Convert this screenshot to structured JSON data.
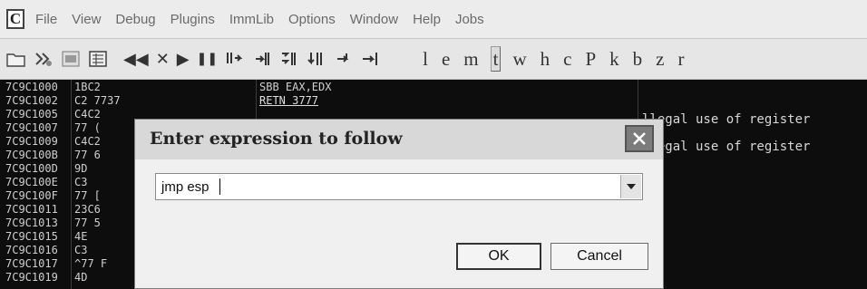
{
  "menu": {
    "app_icon_letter": "C",
    "items": [
      "File",
      "View",
      "Debug",
      "Plugins",
      "ImmLib",
      "Options",
      "Window",
      "Help",
      "Jobs"
    ]
  },
  "toolbar": {
    "icons": [
      "open-folder-icon",
      "restart-icon",
      "close-window-icon",
      "attach-icon",
      "rewind-icon",
      "stop-icon",
      "play-icon",
      "pause-icon",
      "step-into-icon",
      "step-over-icon",
      "trace-into-icon",
      "trace-over-icon",
      "execute-till-return-icon",
      "go-to-icon"
    ],
    "glyph_rewind": "◀◀",
    "glyph_stop": "✕",
    "glyph_play": "▶",
    "glyph_pause": "❚❚",
    "letters": [
      "l",
      "e",
      "m",
      "t",
      "w",
      "h",
      "c",
      "P",
      "k",
      "b",
      "z",
      "r"
    ]
  },
  "code": {
    "rows": [
      {
        "addr": "7C9C1000",
        "hex": "1BC2",
        "disasm": "SBB EAX,EDX"
      },
      {
        "addr": "7C9C1002",
        "hex": "C2 7737",
        "disasm": "RETN 3777"
      },
      {
        "addr": "7C9C1005",
        "hex": "C4C2",
        "disasm": ""
      },
      {
        "addr": "7C9C1007",
        "hex": "77 (",
        "disasm": ""
      },
      {
        "addr": "7C9C1009",
        "hex": "C4C2",
        "disasm": ""
      },
      {
        "addr": "7C9C100B",
        "hex": "77 6",
        "disasm": ""
      },
      {
        "addr": "7C9C100D",
        "hex": "9D",
        "disasm": ""
      },
      {
        "addr": "7C9C100E",
        "hex": "C3",
        "disasm": ""
      },
      {
        "addr": "7C9C100F",
        "hex": "77 [",
        "disasm": ""
      },
      {
        "addr": "7C9C1011",
        "hex": "23C6",
        "disasm": ""
      },
      {
        "addr": "7C9C1013",
        "hex": "77 5",
        "disasm": ""
      },
      {
        "addr": "7C9C1015",
        "hex": "4E",
        "disasm": ""
      },
      {
        "addr": "7C9C1016",
        "hex": "C3",
        "disasm": ""
      },
      {
        "addr": "7C9C1017",
        "hex": "^77 F",
        "disasm": ""
      },
      {
        "addr": "7C9C1019",
        "hex": "4D",
        "disasm": ""
      }
    ],
    "comments": [
      "llegal use of register",
      "llegal use of register"
    ]
  },
  "dialog": {
    "title": "Enter expression to follow",
    "input_value": "jmp esp",
    "ok_label": "OK",
    "cancel_label": "Cancel"
  }
}
